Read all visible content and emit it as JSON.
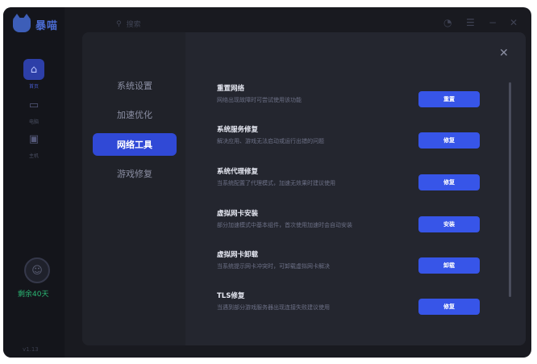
{
  "app": {
    "name": "暴喵"
  },
  "topbar": {
    "search_placeholder": "搜索"
  },
  "rail": {
    "items": [
      {
        "label": "首页"
      },
      {
        "label": "电脑"
      },
      {
        "label": "主机"
      }
    ],
    "membership": "剩余40天",
    "version": "v1.13"
  },
  "modal": {
    "nav": [
      "系统设置",
      "加速优化",
      "网络工具",
      "游戏修复"
    ],
    "active_nav": "网络工具",
    "tools": [
      {
        "title": "重置网络",
        "desc": "网络出现故障时可尝试使用该功能",
        "button": "重置"
      },
      {
        "title": "系统服务修复",
        "desc": "解决应用、游戏无法启动或运行出错的问题",
        "button": "修复"
      },
      {
        "title": "系统代理修复",
        "desc": "当系统配置了代理模式，加速无效果时建议使用",
        "button": "修复"
      },
      {
        "title": "虚拟网卡安装",
        "desc": "部分加速模式中基本组件，首次使用加速时会自动安装",
        "button": "安装"
      },
      {
        "title": "虚拟网卡卸载",
        "desc": "当系统提示网卡冲突时，可卸载虚拟网卡解决",
        "button": "卸载"
      },
      {
        "title": "TLS修复",
        "desc": "当遇到部分游戏服务器出现连接失败建议使用",
        "button": "修复"
      }
    ]
  },
  "colors": {
    "accent": "#3755e8",
    "active_nav": "#3049d6",
    "green": "#2bb673"
  }
}
